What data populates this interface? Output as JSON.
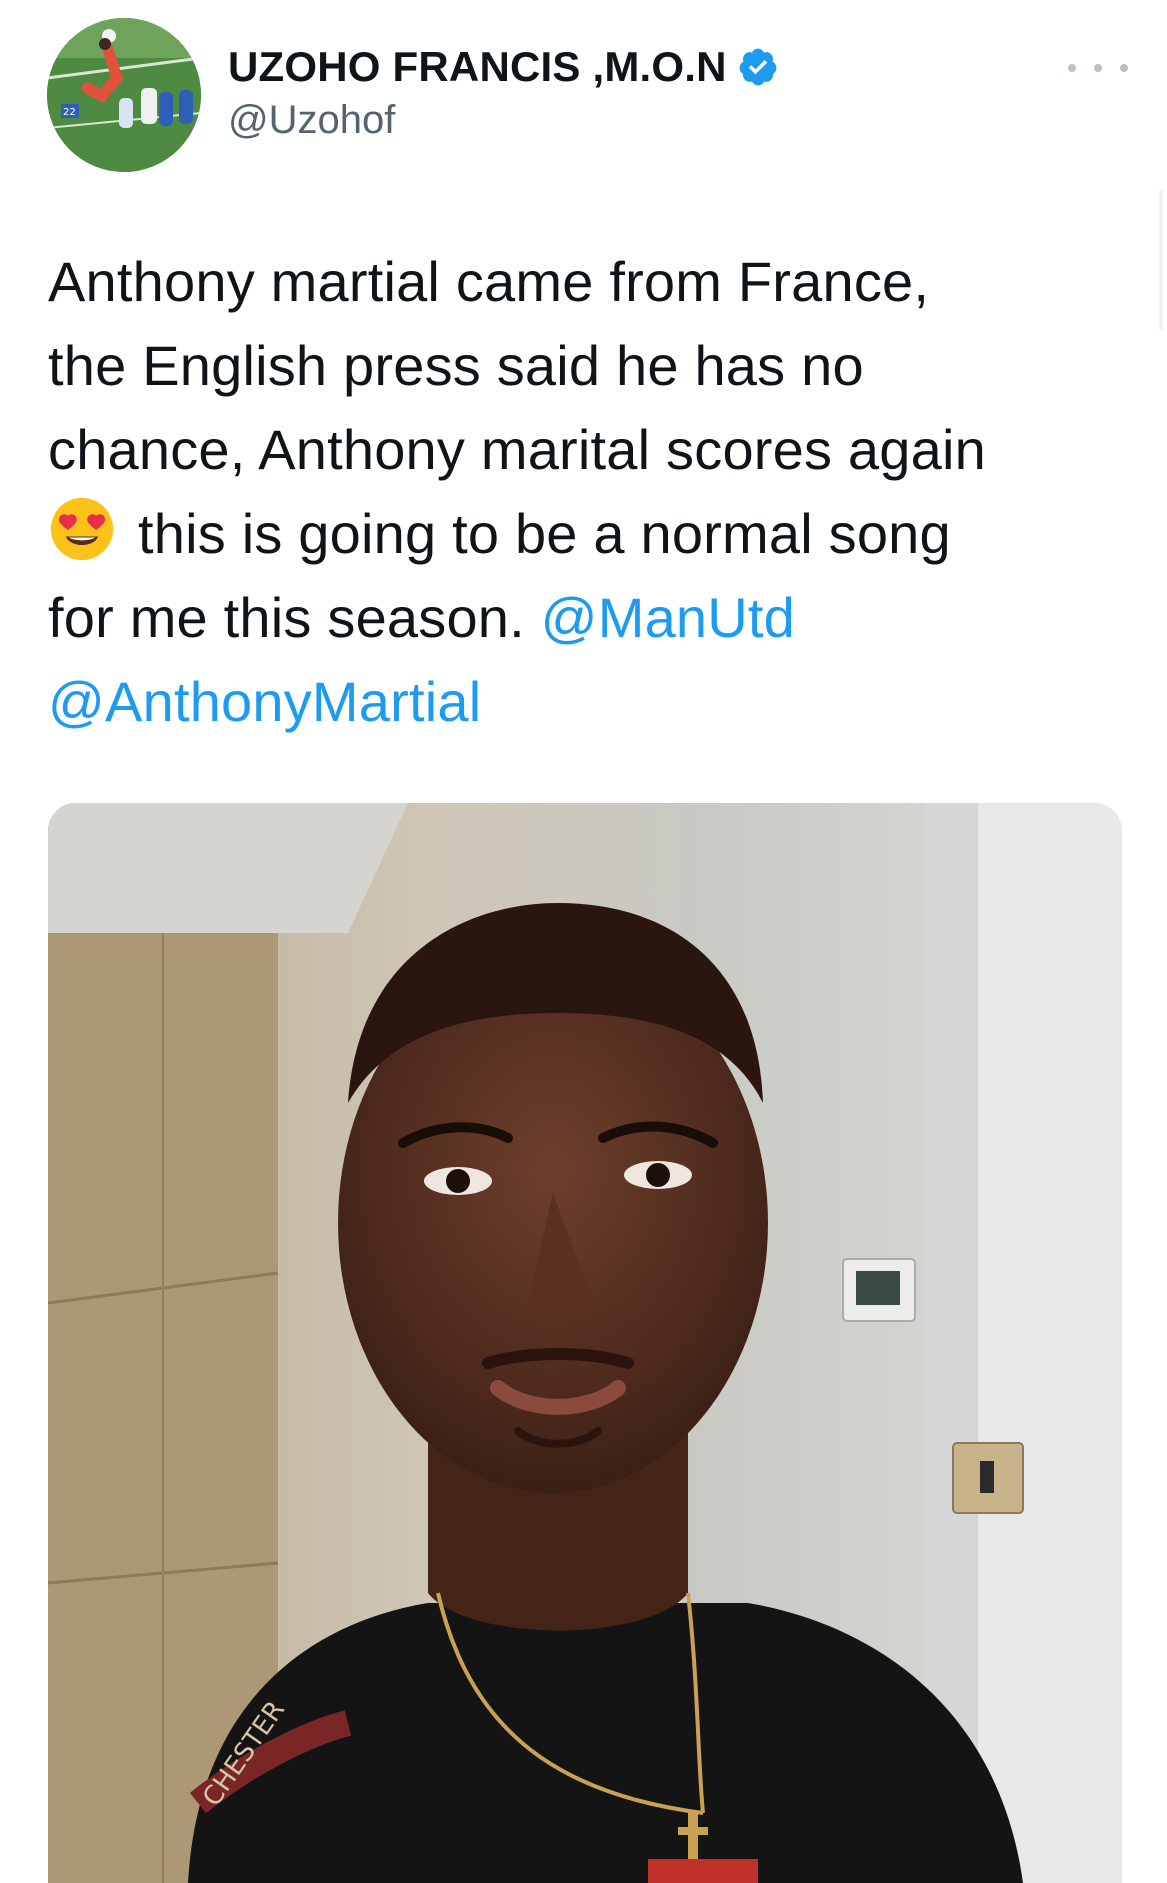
{
  "tweet": {
    "author": {
      "display_name": "UZOHO FRANCIS ,M.O.N",
      "handle": "@Uzohof",
      "verified": true,
      "avatar_icon": "goalkeeper-diving-avatar-icon"
    },
    "more_icon": "more-dots-icon",
    "text": {
      "line1": "Anthony martial came from France,",
      "line2": "the English press said he has no",
      "line3": "chance, Anthony marital scores again",
      "line4_emoji": "heart-eyes-emoji-icon",
      "line4": "this is going to be a normal song",
      "line5": "for me this season. ",
      "mention1": "@ManUtd",
      "mention2": "@AnthonyMartial"
    },
    "media": {
      "kind": "photo",
      "shirt_text": "CHESTER"
    }
  },
  "colors": {
    "mention": "#1d9bf0",
    "verified": "#1d9bf0",
    "handle": "#536471",
    "text": "#0f1419"
  }
}
